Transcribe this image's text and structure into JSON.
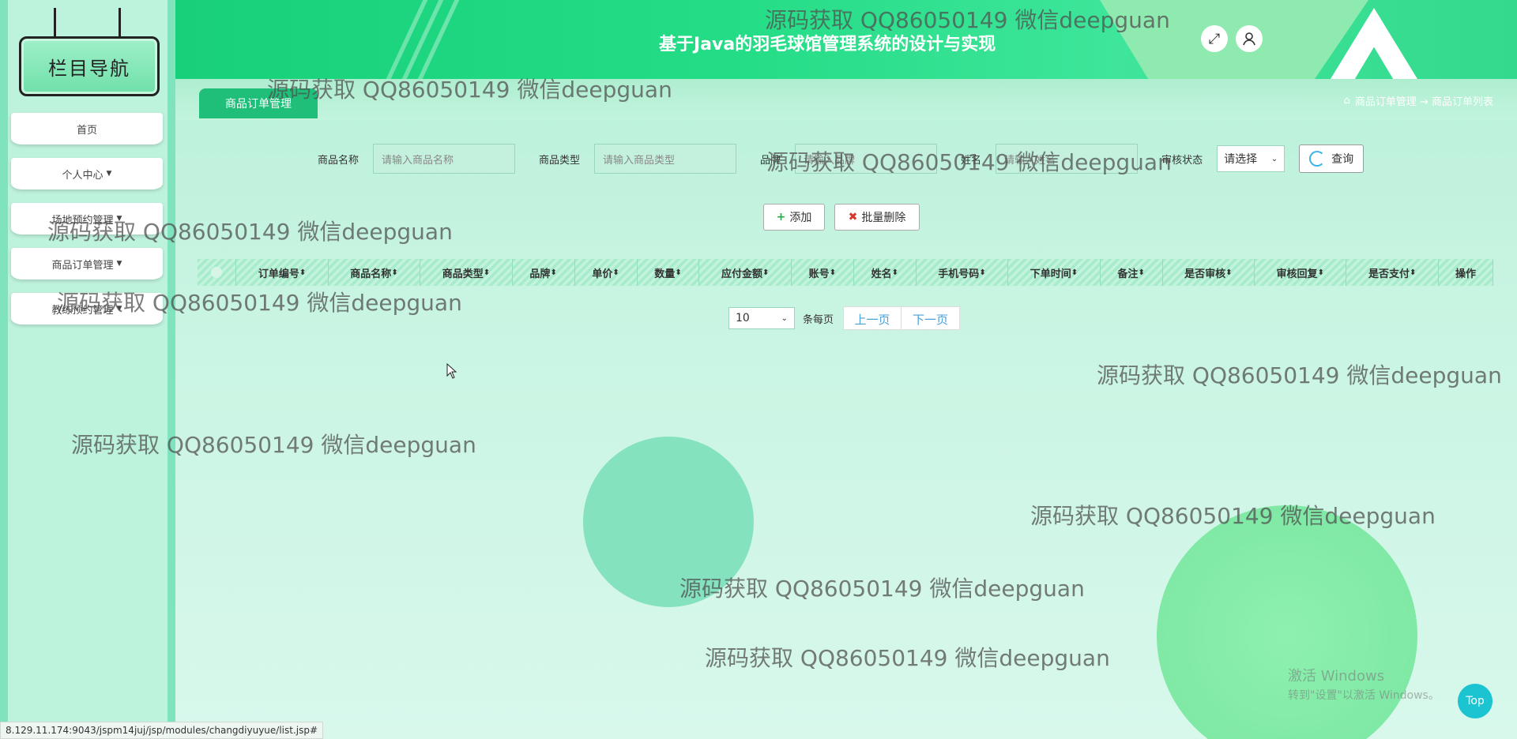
{
  "sidebar": {
    "title": "栏目导航",
    "items": [
      {
        "label": "首页",
        "has_caret": false
      },
      {
        "label": "个人中心",
        "has_caret": true
      },
      {
        "label": "场地预约管理",
        "has_caret": true
      },
      {
        "label": "商品订单管理",
        "has_caret": true
      },
      {
        "label": "教练预约管理",
        "has_caret": true
      }
    ]
  },
  "header": {
    "title": "基于Java的羽毛球馆管理系统的设计与实现",
    "fullscreen_icon": "expand-icon",
    "user_icon": "user-icon"
  },
  "breadcrumb": {
    "tab": "商品订单管理",
    "path_home_icon": "home-icon",
    "path": "商品订单管理 → 商品订单列表"
  },
  "search": {
    "fields": [
      {
        "label": "商品名称",
        "placeholder": "请输入商品名称"
      },
      {
        "label": "商品类型",
        "placeholder": "请输入商品类型"
      },
      {
        "label": "品牌",
        "placeholder": "请输入品牌"
      },
      {
        "label": "姓名",
        "placeholder": "请输入姓名"
      }
    ],
    "status_label": "审核状态",
    "status_select": "请选择",
    "query_button": "查询"
  },
  "actions": {
    "add": "添加",
    "batch_delete": "批量删除"
  },
  "table": {
    "columns": [
      "订单编号",
      "商品名称",
      "商品类型",
      "品牌",
      "单价",
      "数量",
      "应付金额",
      "账号",
      "姓名",
      "手机号码",
      "下单时间",
      "备注",
      "是否审核",
      "审核回复",
      "是否支付",
      "操作"
    ],
    "rows": []
  },
  "pager": {
    "page_size": "10",
    "per_page_label": "条每页",
    "prev": "上一页",
    "next": "下一页"
  },
  "watermark": "源码获取 QQ86050149 微信deepguan",
  "status_url": "8.129.11.174:9043/jspm14juj/jsp/modules/changdiyuyue/list.jsp#",
  "windows": {
    "line1": "激活 Windows",
    "line2": "转到\"设置\"以激活 Windows。"
  },
  "top_button": "Top",
  "colors": {
    "accent": "#1fbf7a",
    "header": "#23dc85",
    "top_button": "#1bc4d0"
  }
}
